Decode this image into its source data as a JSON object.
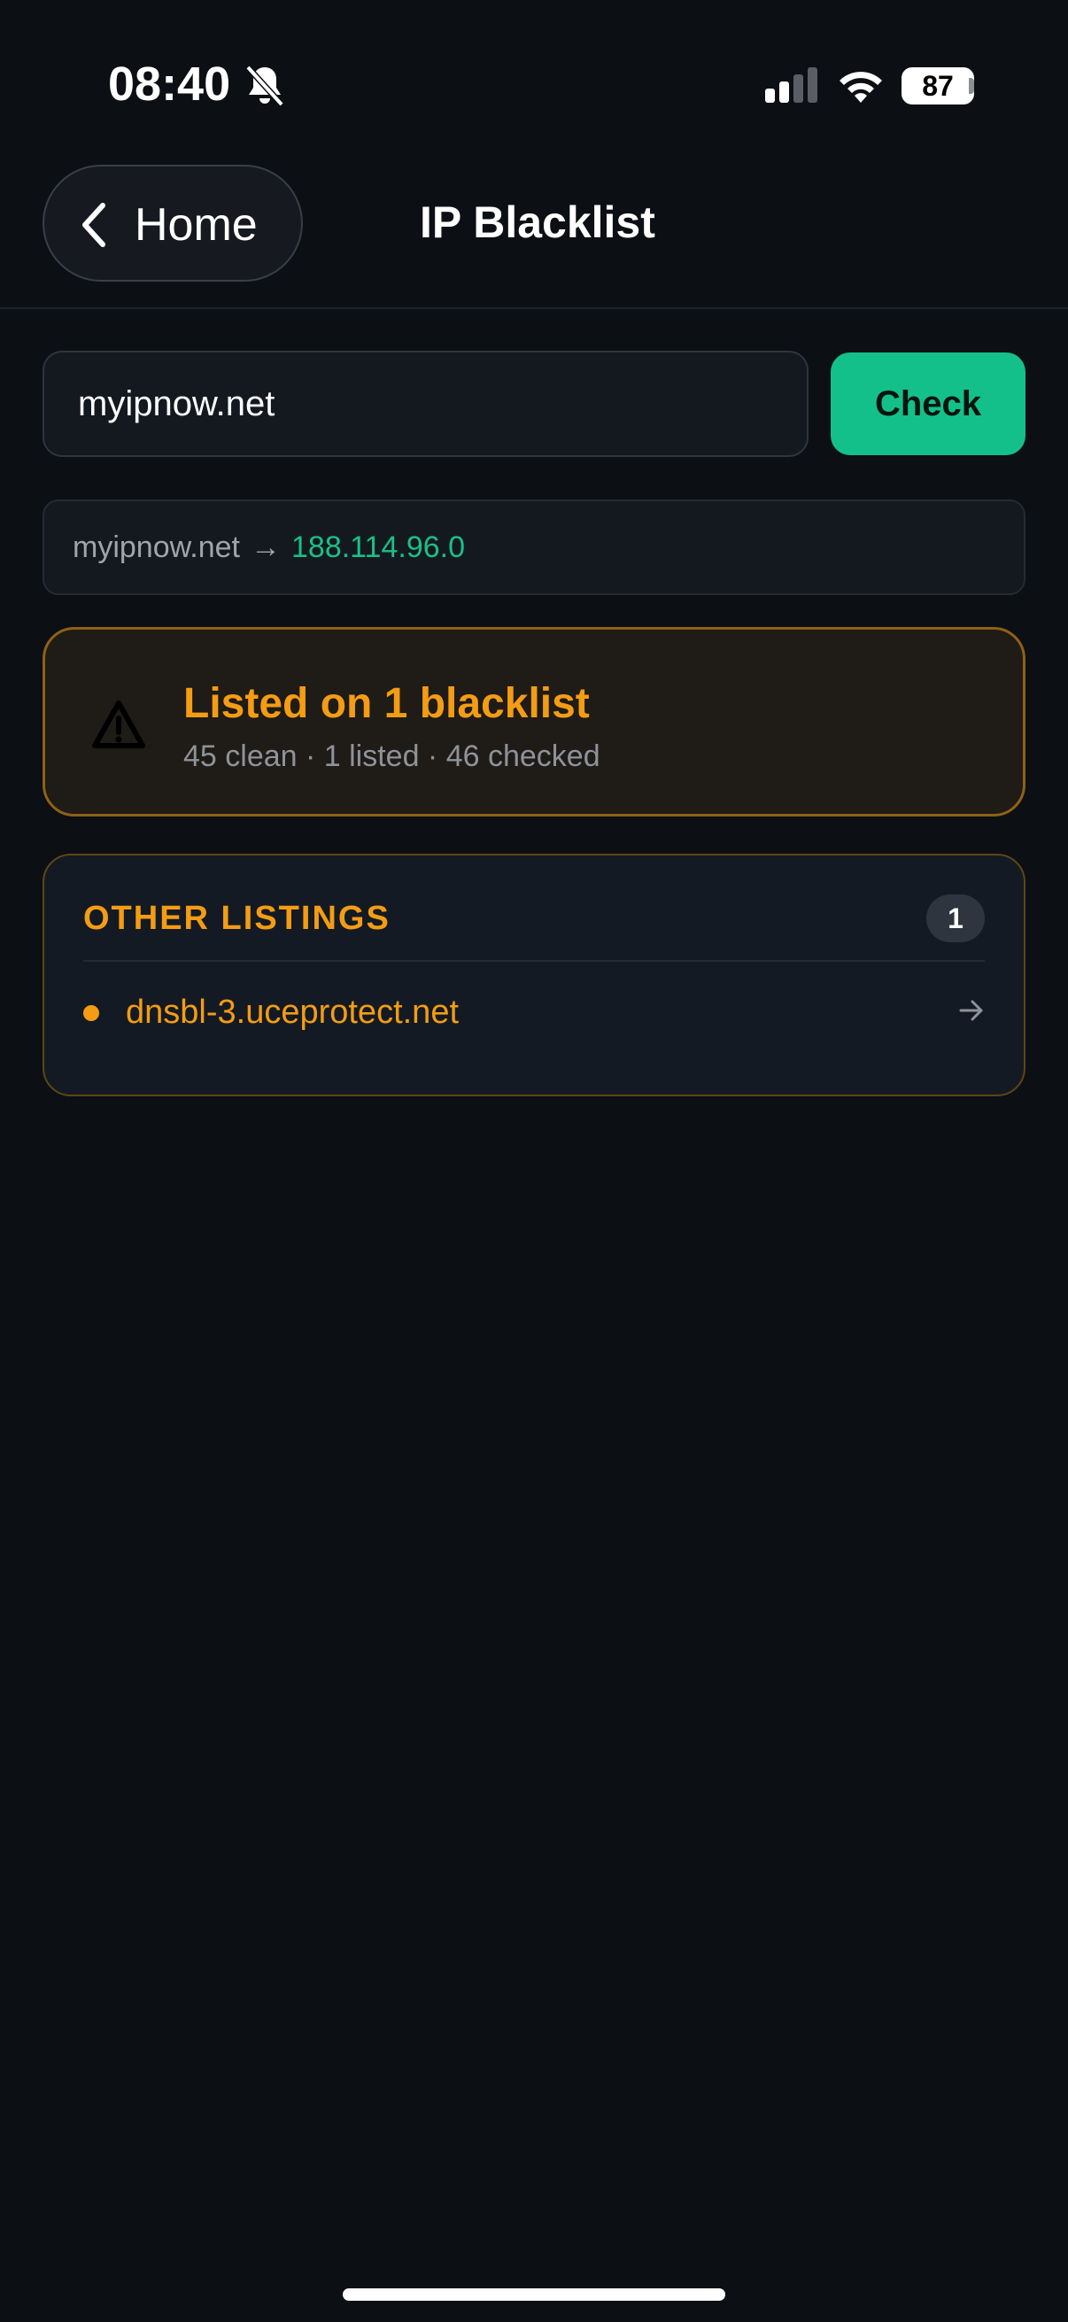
{
  "status_bar": {
    "time": "08:40",
    "battery_level": "87",
    "icons": [
      "bell-slash-icon",
      "signal-icon",
      "wifi-icon",
      "battery-icon"
    ]
  },
  "nav": {
    "back_label": "Home",
    "title": "IP Blacklist"
  },
  "search": {
    "value": "myipnow.net",
    "check_label": "Check"
  },
  "resolved": {
    "domain": "myipnow.net",
    "arrow": "→",
    "ip": "188.114.96.0"
  },
  "alert": {
    "title": "Listed on 1 blacklist",
    "summary": "45 clean · 1 listed · 46 checked"
  },
  "listings": {
    "heading": "OTHER LISTINGS",
    "count": "1",
    "items": [
      {
        "name": "dnsbl-3.uceprotect.net"
      }
    ]
  },
  "colors": {
    "background": "#0c0f14",
    "accent_green": "#14c08a",
    "warning_orange": "#f39c14",
    "ip_green": "#1cbf85"
  }
}
